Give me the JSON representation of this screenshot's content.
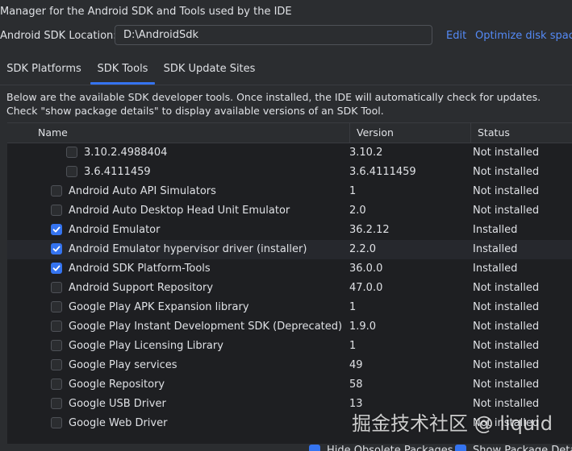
{
  "header": {
    "description": "Manager for the Android SDK and Tools used by the IDE",
    "location_label": "Android SDK Location:",
    "location_value": "D:\\AndroidSdk",
    "edit_label": "Edit",
    "optimize_label": "Optimize disk space"
  },
  "tabs": [
    {
      "label": "SDK Platforms",
      "active": false
    },
    {
      "label": "SDK Tools",
      "active": true
    },
    {
      "label": "SDK Update Sites",
      "active": false
    }
  ],
  "info_text": "Below are the available SDK developer tools. Once installed, the IDE will automatically check for updates. Check \"show package details\" to display available versions of an SDK Tool.",
  "table": {
    "columns": [
      "Name",
      "Version",
      "Status"
    ],
    "rows": [
      {
        "name": "3.10.2.4988404",
        "version": "3.10.2",
        "status": "Not installed",
        "checked": false,
        "indent": 2
      },
      {
        "name": "3.6.4111459",
        "version": "3.6.4111459",
        "status": "Not installed",
        "checked": false,
        "indent": 2
      },
      {
        "name": "Android Auto API Simulators",
        "version": "1",
        "status": "Not installed",
        "checked": false,
        "indent": 1
      },
      {
        "name": "Android Auto Desktop Head Unit Emulator",
        "version": "2.0",
        "status": "Not installed",
        "checked": false,
        "indent": 1
      },
      {
        "name": "Android Emulator",
        "version": "36.2.12",
        "status": "Installed",
        "checked": true,
        "indent": 1
      },
      {
        "name": "Android Emulator hypervisor driver (installer)",
        "version": "2.2.0",
        "status": "Installed",
        "checked": true,
        "indent": 1,
        "hover": true
      },
      {
        "name": "Android SDK Platform-Tools",
        "version": "36.0.0",
        "status": "Installed",
        "checked": true,
        "indent": 1
      },
      {
        "name": "Android Support Repository",
        "version": "47.0.0",
        "status": "Not installed",
        "checked": false,
        "indent": 1
      },
      {
        "name": "Google Play APK Expansion library",
        "version": "1",
        "status": "Not installed",
        "checked": false,
        "indent": 1
      },
      {
        "name": "Google Play Instant Development SDK (Deprecated)",
        "version": "1.9.0",
        "status": "Not installed",
        "checked": false,
        "indent": 1
      },
      {
        "name": "Google Play Licensing Library",
        "version": "1",
        "status": "Not installed",
        "checked": false,
        "indent": 1
      },
      {
        "name": "Google Play services",
        "version": "49",
        "status": "Not installed",
        "checked": false,
        "indent": 1
      },
      {
        "name": "Google Repository",
        "version": "58",
        "status": "Not installed",
        "checked": false,
        "indent": 1
      },
      {
        "name": "Google USB Driver",
        "version": "13",
        "status": "Not installed",
        "checked": false,
        "indent": 1
      },
      {
        "name": "Google Web Driver",
        "version": "",
        "status": "Not installed",
        "checked": false,
        "indent": 1
      }
    ]
  },
  "footer": {
    "hide_obsolete_label": "Hide Obsolete Packages",
    "show_details_label": "Show Package Details"
  },
  "watermark": "掘金技术社区 @ liquid",
  "colors": {
    "accent": "#3574f0",
    "link": "#548af7",
    "background": "#2b2d30",
    "table_background": "#1e1f22"
  }
}
